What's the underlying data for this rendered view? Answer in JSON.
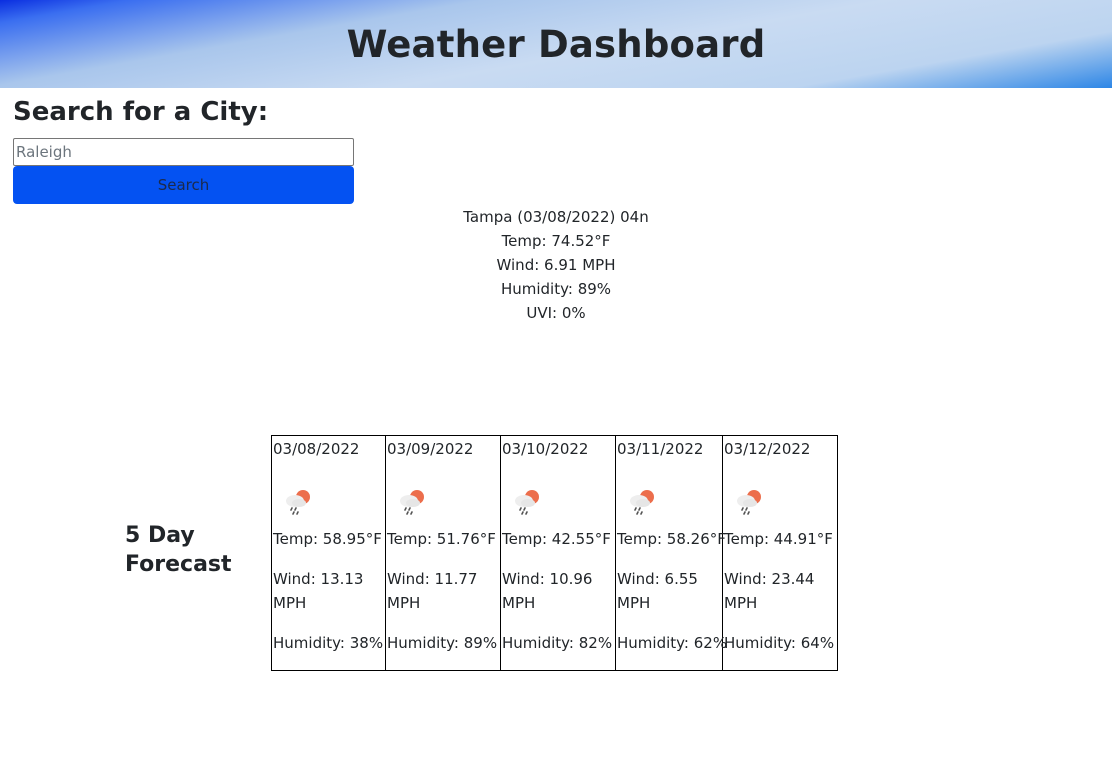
{
  "header": {
    "title": "Weather Dashboard"
  },
  "search": {
    "heading": "Search for a City:",
    "placeholder": "Raleigh",
    "value": "",
    "button_label": "Search",
    "button_color": "#0452f2"
  },
  "current": {
    "title": "Tampa (03/08/2022) 04n",
    "temp": "Temp: 74.52°F",
    "wind": "Wind: 6.91 MPH",
    "humidity": "Humidity: 89%",
    "uvi": "UVI: 0%"
  },
  "forecast": {
    "title": "5 Day Forecast",
    "days": [
      {
        "date": "03/08/2022",
        "icon": "rain-cloud-sun-icon",
        "temp": "Temp: 58.95°F",
        "wind": "Wind: 13.13 MPH",
        "humidity": "Humidity: 38%"
      },
      {
        "date": "03/09/2022",
        "icon": "rain-cloud-sun-icon",
        "temp": "Temp: 51.76°F",
        "wind": "Wind: 11.77 MPH",
        "humidity": "Humidity: 89%"
      },
      {
        "date": "03/10/2022",
        "icon": "rain-cloud-sun-icon",
        "temp": "Temp: 42.55°F",
        "wind": "Wind: 10.96 MPH",
        "humidity": "Humidity: 82%"
      },
      {
        "date": "03/11/2022",
        "icon": "rain-cloud-sun-icon",
        "temp": "Temp: 58.26°F",
        "wind": "Wind: 6.55 MPH",
        "humidity": "Humidity: 62%"
      },
      {
        "date": "03/12/2022",
        "icon": "rain-cloud-sun-icon",
        "temp": "Temp: 44.91°F",
        "wind": "Wind: 23.44 MPH",
        "humidity": "Humidity: 64%"
      }
    ]
  }
}
